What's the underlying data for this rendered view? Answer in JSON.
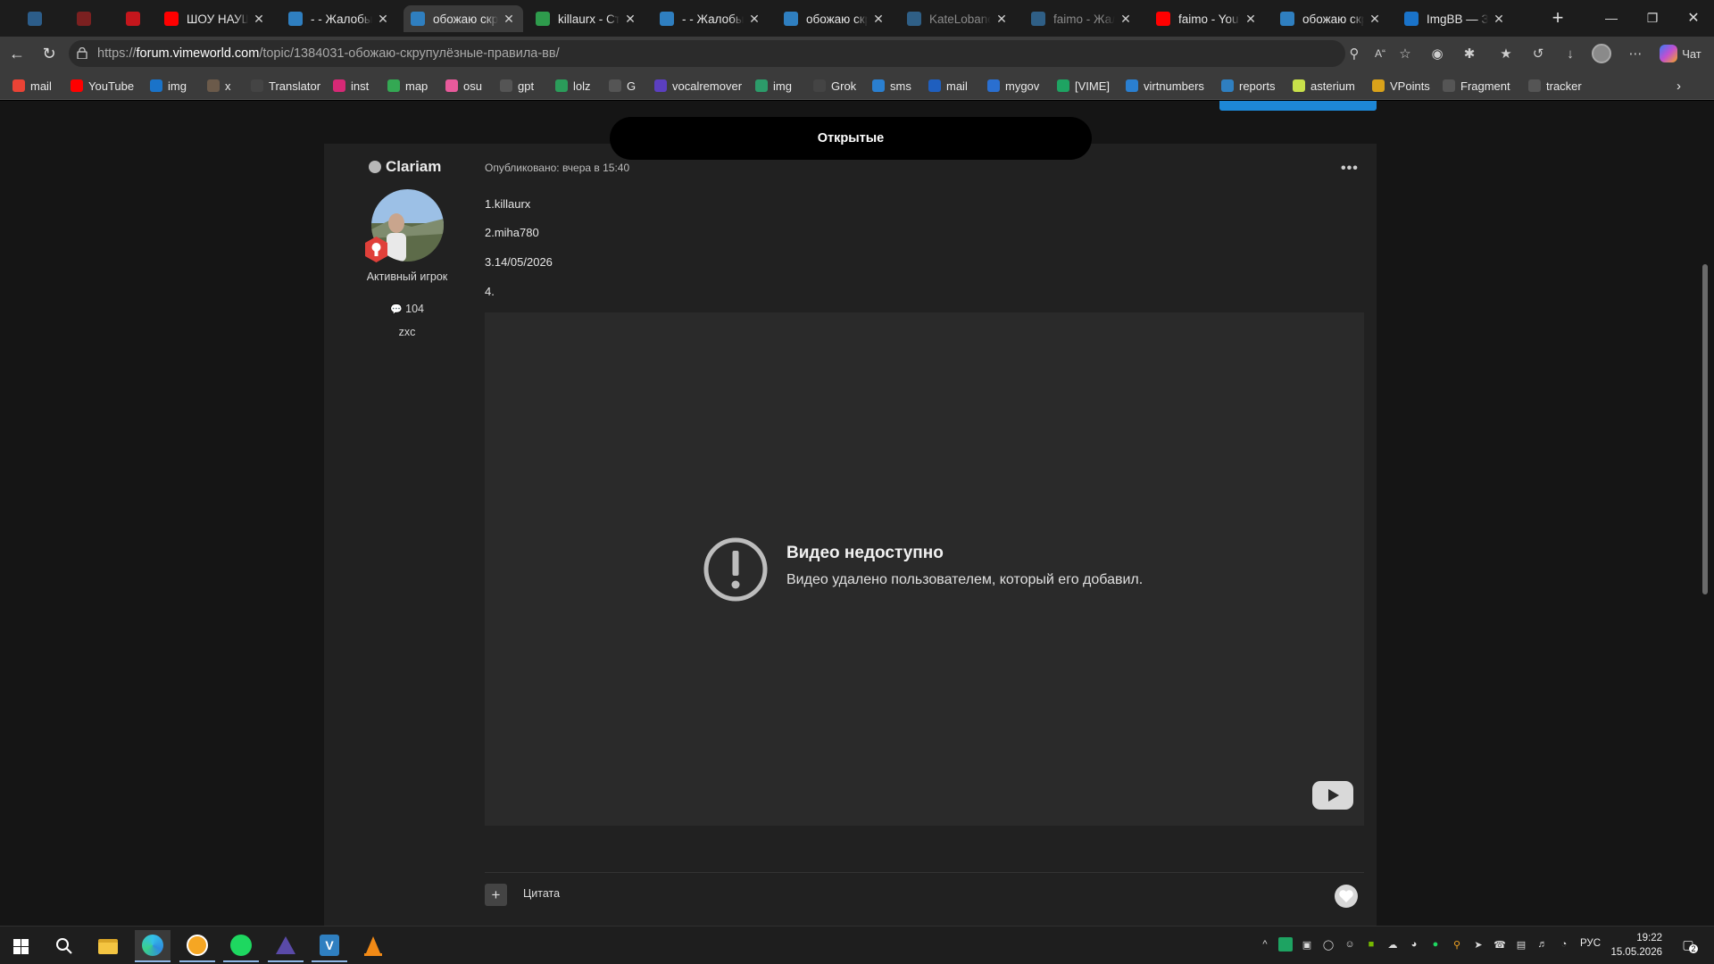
{
  "tabs": [
    {
      "title": "",
      "favicon": "vimeworld-icon",
      "color": "#2c5d8a",
      "dim": true
    },
    {
      "title": "",
      "favicon": "vimeworld-red-icon",
      "color": "#7b2020",
      "dim": true
    },
    {
      "title": "",
      "favicon": "youtube-icon",
      "color": "#c4161c",
      "dim": true
    },
    {
      "title": "ШОУ НАУШНИ",
      "favicon": "youtube-icon",
      "color": "#ff0000"
    },
    {
      "title": "- - Жалобы на",
      "favicon": "vimeworld-icon",
      "color": "#2f7fc0"
    },
    {
      "title": "обожаю скрул",
      "favicon": "vimeworld-icon",
      "color": "#2f7fc0",
      "active": true
    },
    {
      "title": "killaurx - Стати",
      "favicon": "stats-icon",
      "color": "#2e9b4c"
    },
    {
      "title": "- - Жалобы на",
      "favicon": "vimeworld-icon",
      "color": "#2f7fc0"
    },
    {
      "title": "обожаю скрул",
      "favicon": "vimeworld-icon",
      "color": "#2f7fc0"
    },
    {
      "title": "KateLobanova",
      "favicon": "vimeworld-icon",
      "color": "#2f5f86",
      "dim": true
    },
    {
      "title": "faimo - Жалоб",
      "favicon": "vimeworld-icon",
      "color": "#2f5f86",
      "dim": true
    },
    {
      "title": "faimo - YouTub",
      "favicon": "youtube-icon",
      "color": "#ff0000"
    },
    {
      "title": "обожаю скрул",
      "favicon": "vimeworld-icon",
      "color": "#2f7fc0"
    },
    {
      "title": "ImgBB — Загру",
      "favicon": "imgbb-icon",
      "color": "#1a73c9"
    }
  ],
  "address": {
    "prefix": "https://",
    "domain": "forum.vimeworld.com",
    "path": "/topic/1384031-обожаю-скрупулёзные-правила-вв/"
  },
  "copilot_label": "Чат",
  "bookmarks": [
    {
      "label": "mail",
      "icon": "gmail-icon",
      "color": "#ea4335"
    },
    {
      "label": "YouTube",
      "icon": "youtube-icon",
      "color": "#ff0000"
    },
    {
      "label": "img",
      "icon": "imgbb-icon",
      "color": "#1a73c9"
    },
    {
      "label": "x",
      "icon": "x-icon",
      "color": "#6b5a4a"
    },
    {
      "label": "Translator",
      "icon": "translator-icon",
      "color": "#444"
    },
    {
      "label": "inst",
      "icon": "instagram-icon",
      "color": "#d62976"
    },
    {
      "label": "map",
      "icon": "maps-icon",
      "color": "#34a853"
    },
    {
      "label": "osu",
      "icon": "osu-icon",
      "color": "#e85a9b"
    },
    {
      "label": "gpt",
      "icon": "chatgpt-icon",
      "color": "#555"
    },
    {
      "label": "lolz",
      "icon": "lolz-icon",
      "color": "#2b9c5a"
    },
    {
      "label": "G",
      "icon": "stack-icon",
      "color": "#555"
    },
    {
      "label": "vocalremover",
      "icon": "vocalremover-icon",
      "color": "#5b3fc0"
    },
    {
      "label": "img",
      "icon": "img-icon",
      "color": "#2c9b6a"
    },
    {
      "label": "Grok",
      "icon": "grok-icon",
      "color": "#444"
    },
    {
      "label": "sms",
      "icon": "sms-icon",
      "color": "#2a7fd0"
    },
    {
      "label": "mail",
      "icon": "mailru-icon",
      "color": "#1f5fbf"
    },
    {
      "label": "mygov",
      "icon": "mygov-icon",
      "color": "#2a6fd0"
    },
    {
      "label": "[VIME]",
      "icon": "sheets-icon",
      "color": "#1ea362"
    },
    {
      "label": "virtnumbers",
      "icon": "virtnumbers-icon",
      "color": "#2a7fd0"
    },
    {
      "label": "reports",
      "icon": "vimeworld-icon",
      "color": "#2f7fc0"
    },
    {
      "label": "asterium",
      "icon": "asterium-icon",
      "color": "#c8e04a"
    },
    {
      "label": "VPoints",
      "icon": "vpoints-icon",
      "color": "#d9a21a"
    },
    {
      "label": "Fragment",
      "icon": "fragment-icon",
      "color": "#555"
    },
    {
      "label": "tracker",
      "icon": "tracker-icon",
      "color": "#555"
    }
  ],
  "filter_label": "Открытые",
  "author": {
    "name": "Clariam",
    "rank": "Активный игрок",
    "posts": "104",
    "title": "zxc"
  },
  "post": {
    "published": "Опубликовано: вчера в 15:40",
    "lines": [
      "1.killaurx",
      "2.miha780",
      "3.14/05/2026",
      "4."
    ]
  },
  "video": {
    "title": "Видео недоступно",
    "subtitle": "Видео удалено пользователем, который его добавил."
  },
  "quote_label": "Цитата",
  "tray": {
    "lang": "РУС",
    "time": "19:22",
    "date": "15.05.2026",
    "notifications": "2"
  }
}
